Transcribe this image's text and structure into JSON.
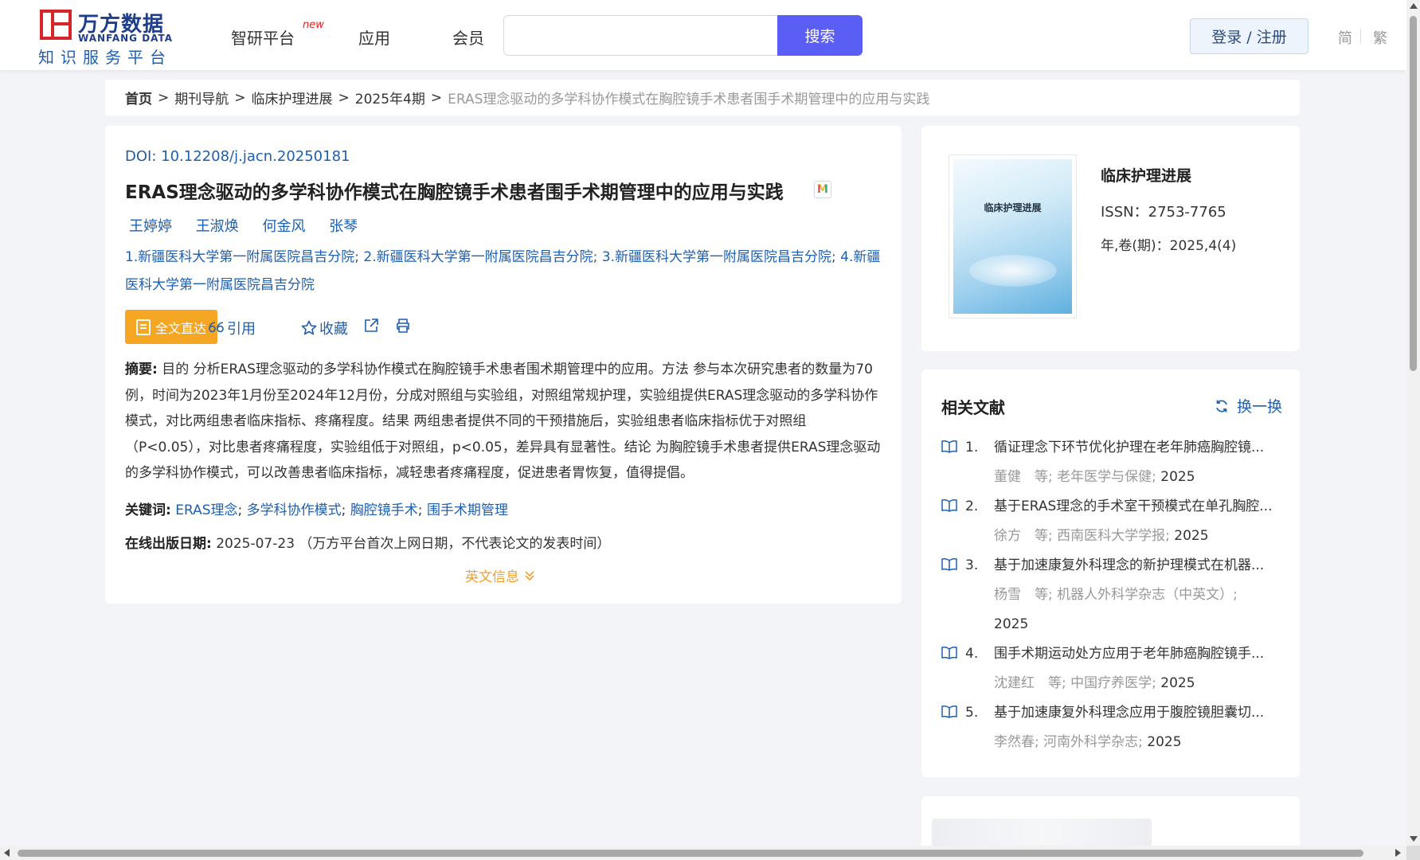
{
  "header": {
    "logo_cn": "万方数据",
    "logo_en": "WANFANG DATA",
    "logo_sub": "知识服务平台",
    "nav": [
      {
        "label": "智研平台",
        "badge": "new"
      },
      {
        "label": "应用"
      },
      {
        "label": "会员"
      }
    ],
    "search_value": "",
    "search_button": "搜索",
    "login_button": "登录 / 注册",
    "lang_simplified": "简",
    "lang_traditional": "繁"
  },
  "breadcrumb": {
    "home": "首页",
    "sep": ">",
    "items": [
      "期刊导航",
      "临床护理进展",
      "2025年4期"
    ],
    "current": "ERAS理念驱动的多学科协作模式在胸腔镜手术患者围手术期管理中的应用与实践"
  },
  "article": {
    "doi_label": "DOI:",
    "doi": "10.12208/j.jacn.20250181",
    "title": "ERAS理念驱动的多学科协作模式在胸腔镜手术患者围手术期管理中的应用与实践",
    "title_badge": "M",
    "authors": [
      "王婷婷",
      "王淑焕",
      "何金风",
      "张琴"
    ],
    "affiliations": [
      "1.新疆医科大学第一附属医院昌吉分院",
      "2.新疆医科大学第一附属医院昌吉分院",
      "3.新疆医科大学第一附属医院昌吉分院",
      "4.新疆医科大学第一附属医院昌吉分院"
    ],
    "affil_sep": ";",
    "actions": {
      "fulltext": "全文直达",
      "cite": "引用",
      "favorite": "收藏"
    },
    "abstract_label": "摘要:",
    "abstract": "目的 分析ERAS理念驱动的多学科协作模式在胸腔镜手术患者围术期管理中的应用。方法 参与本次研究患者的数量为70例，时间为2023年1月份至2024年12月份，分成对照组与实验组，对照组常规护理，实验组提供ERAS理念驱动的多学科协作模式，对比两组患者临床指标、疼痛程度。结果 两组患者提供不同的干预措施后，实验组患者临床指标优于对照组（P<0.05），对比患者疼痛程度，实验组低于对照组，p<0.05，差异具有显著性。结论 为胸腔镜手术患者提供ERAS理念驱动的多学科协作模式，可以改善患者临床指标，减轻患者疼痛程度，促进患者胃恢复，值得提倡。",
    "keywords_label": "关键词:",
    "keywords": [
      "ERAS理念",
      "多学科协作模式",
      "胸腔镜手术",
      "围手术期管理"
    ],
    "keyword_sep": ";",
    "pubdate_label": "在线出版日期:",
    "pubdate": "2025-07-23",
    "pubdate_note": "（万方平台首次上网日期，不代表论文的发表时间）",
    "english_info": "英文信息"
  },
  "journal": {
    "cover_title": "临床护理进展",
    "name": "临床护理进展",
    "issn": "ISSN：2753-7765",
    "year_vol": "年,卷(期)：2025,4(4)"
  },
  "related": {
    "title": "相关文献",
    "refresh": "换一换",
    "items": [
      {
        "num": "1.",
        "title": "循证理念下环节优化护理在老年肺癌胸腔镜...",
        "authors": "董健　等;",
        "source": "老年医学与保健;",
        "year": "2025"
      },
      {
        "num": "2.",
        "title": "基于ERAS理念的手术室干预模式在单孔胸腔...",
        "authors": "徐方　等;",
        "source": "西南医科大学学报;",
        "year": "2025"
      },
      {
        "num": "3.",
        "title": "基于加速康复外科理念的新护理模式在机器...",
        "authors": "杨雪　等;",
        "source": "机器人外科学杂志（中英文）;",
        "year": "2025"
      },
      {
        "num": "4.",
        "title": "围手术期运动处方应用于老年肺癌胸腔镜手...",
        "authors": "沈建红　等;",
        "source": "中国疗养医学;",
        "year": "2025"
      },
      {
        "num": "5.",
        "title": "基于加速康复外科理念应用于腹腔镜胆囊切...",
        "authors": "李然春;",
        "source": "河南外科学杂志;",
        "year": "2025"
      }
    ]
  },
  "colors": {
    "primary_blue": "#1e5fb0",
    "search_button": "#5b5ef4",
    "fulltext_orange": "#f5a623",
    "logo_red": "#d6262a",
    "logo_navy": "#1e3e8c"
  }
}
